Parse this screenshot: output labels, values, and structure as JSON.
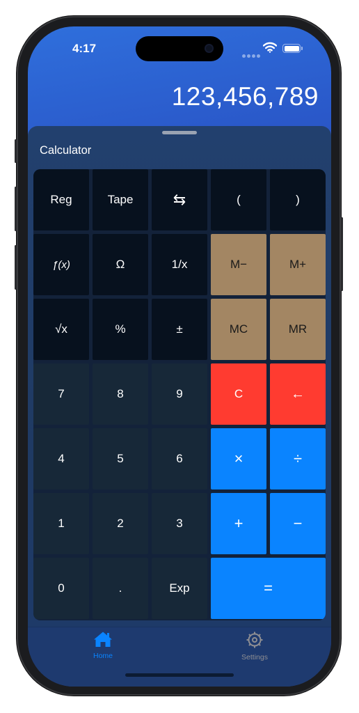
{
  "status_bar": {
    "time": "4:17"
  },
  "display": {
    "value": "123,456,789"
  },
  "sheet": {
    "title": "Calculator"
  },
  "keys": {
    "reg": "Reg",
    "tape": "Tape",
    "swap": "⇆",
    "lparen": "(",
    "rparen": ")",
    "fx": "ƒ(x)",
    "omega": "Ω",
    "reciprocal": "1/x",
    "m_minus": "M−",
    "m_plus": "M+",
    "sqrt": "√x",
    "percent": "%",
    "plus_minus": "±",
    "mc": "MC",
    "mr": "MR",
    "seven": "7",
    "eight": "8",
    "nine": "9",
    "clear": "C",
    "backspace": "←",
    "four": "4",
    "five": "5",
    "six": "6",
    "multiply": "×",
    "divide": "÷",
    "one": "1",
    "two": "2",
    "three": "3",
    "add": "+",
    "subtract": "−",
    "zero": "0",
    "decimal": ".",
    "exp": "Exp",
    "equals": "="
  },
  "tabbar": {
    "items": [
      {
        "label": "Home",
        "icon": "house-icon",
        "selected": true
      },
      {
        "label": "Settings",
        "icon": "gear-icon",
        "selected": false
      }
    ]
  },
  "colors": {
    "memory_key": "#a38663",
    "clear_key": "#ff3b30",
    "operator_key": "#0a84ff",
    "tab_selected": "#0a84ff",
    "tab_unselected": "#8e8e93"
  }
}
